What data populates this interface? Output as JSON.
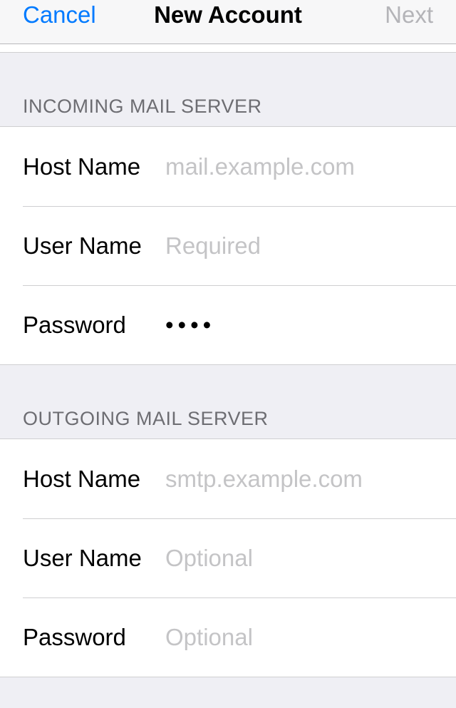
{
  "nav": {
    "cancel": "Cancel",
    "title": "New Account",
    "next": "Next"
  },
  "sections": {
    "incoming": {
      "header": "INCOMING MAIL SERVER",
      "host_label": "Host Name",
      "host_placeholder": "mail.example.com",
      "host_value": "",
      "user_label": "User Name",
      "user_placeholder": "Required",
      "user_value": "",
      "pass_label": "Password",
      "pass_value": "••••"
    },
    "outgoing": {
      "header": "OUTGOING MAIL SERVER",
      "host_label": "Host Name",
      "host_placeholder": "smtp.example.com",
      "host_value": "",
      "user_label": "User Name",
      "user_placeholder": "Optional",
      "user_value": "",
      "pass_label": "Password",
      "pass_placeholder": "Optional",
      "pass_value": ""
    }
  }
}
